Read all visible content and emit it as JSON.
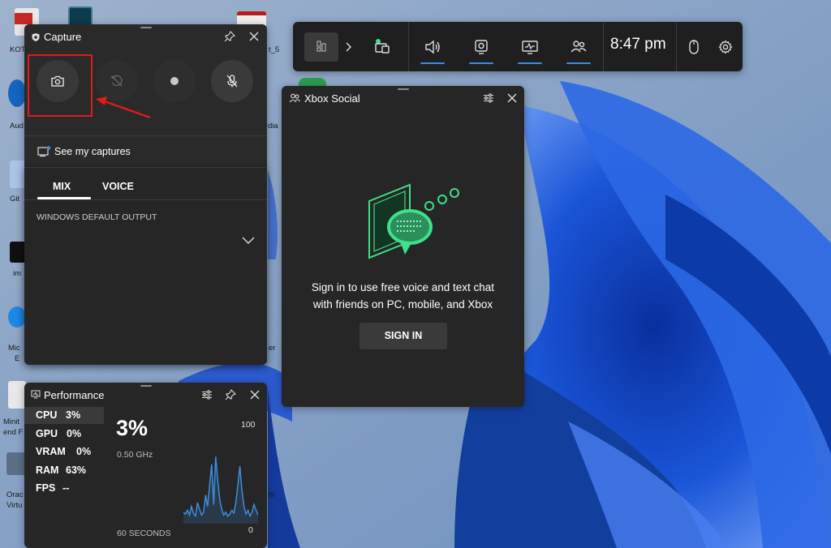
{
  "desktop": {
    "icon_labels": [
      "KOT",
      "Aud",
      "Git",
      "im",
      "Mic",
      "E",
      "Minit",
      "end F",
      "Orac",
      "Virtu",
      "t_5",
      "dia",
      "er",
      "m"
    ]
  },
  "topbar": {
    "clock": "8:47 pm",
    "buttons": [
      "widget-menu",
      "expand",
      "capture",
      "audio",
      "capture-widget",
      "performance",
      "xbox-social",
      "mouse",
      "settings"
    ]
  },
  "capture": {
    "title": "Capture",
    "see_captures": "See my captures",
    "tabs": [
      "MIX",
      "VOICE"
    ],
    "active_tab": "MIX",
    "output_label": "WINDOWS DEFAULT OUTPUT"
  },
  "social": {
    "title": "Xbox Social",
    "message_line1": "Sign in to use free voice and text chat",
    "message_line2": "with friends on PC, mobile, and Xbox",
    "sign_in": "SIGN IN"
  },
  "performance": {
    "title": "Performance",
    "metrics": [
      {
        "name": "CPU",
        "value": "3%"
      },
      {
        "name": "GPU",
        "value": "0%"
      },
      {
        "name": "VRAM",
        "value": "0%"
      },
      {
        "name": "RAM",
        "value": "63%"
      },
      {
        "name": "FPS",
        "value": "--"
      }
    ],
    "big_value": "3%",
    "frequency": "0.50 GHz",
    "axis_max": "100",
    "axis_min": "0",
    "duration": "60 SECONDS",
    "cpu_history": [
      12,
      10,
      14,
      9,
      18,
      11,
      8,
      22,
      15,
      9,
      12,
      30,
      18,
      40,
      62,
      20,
      70,
      45,
      25,
      15,
      9,
      12,
      8,
      10,
      14,
      11,
      22,
      40,
      60,
      35,
      18,
      10,
      14,
      8,
      12,
      20,
      14,
      9
    ]
  },
  "colors": {
    "accent": "#3b8ee0",
    "social_green": "#3ee089",
    "annotation_red": "#e01b1b",
    "widget_bg": "#262626"
  }
}
